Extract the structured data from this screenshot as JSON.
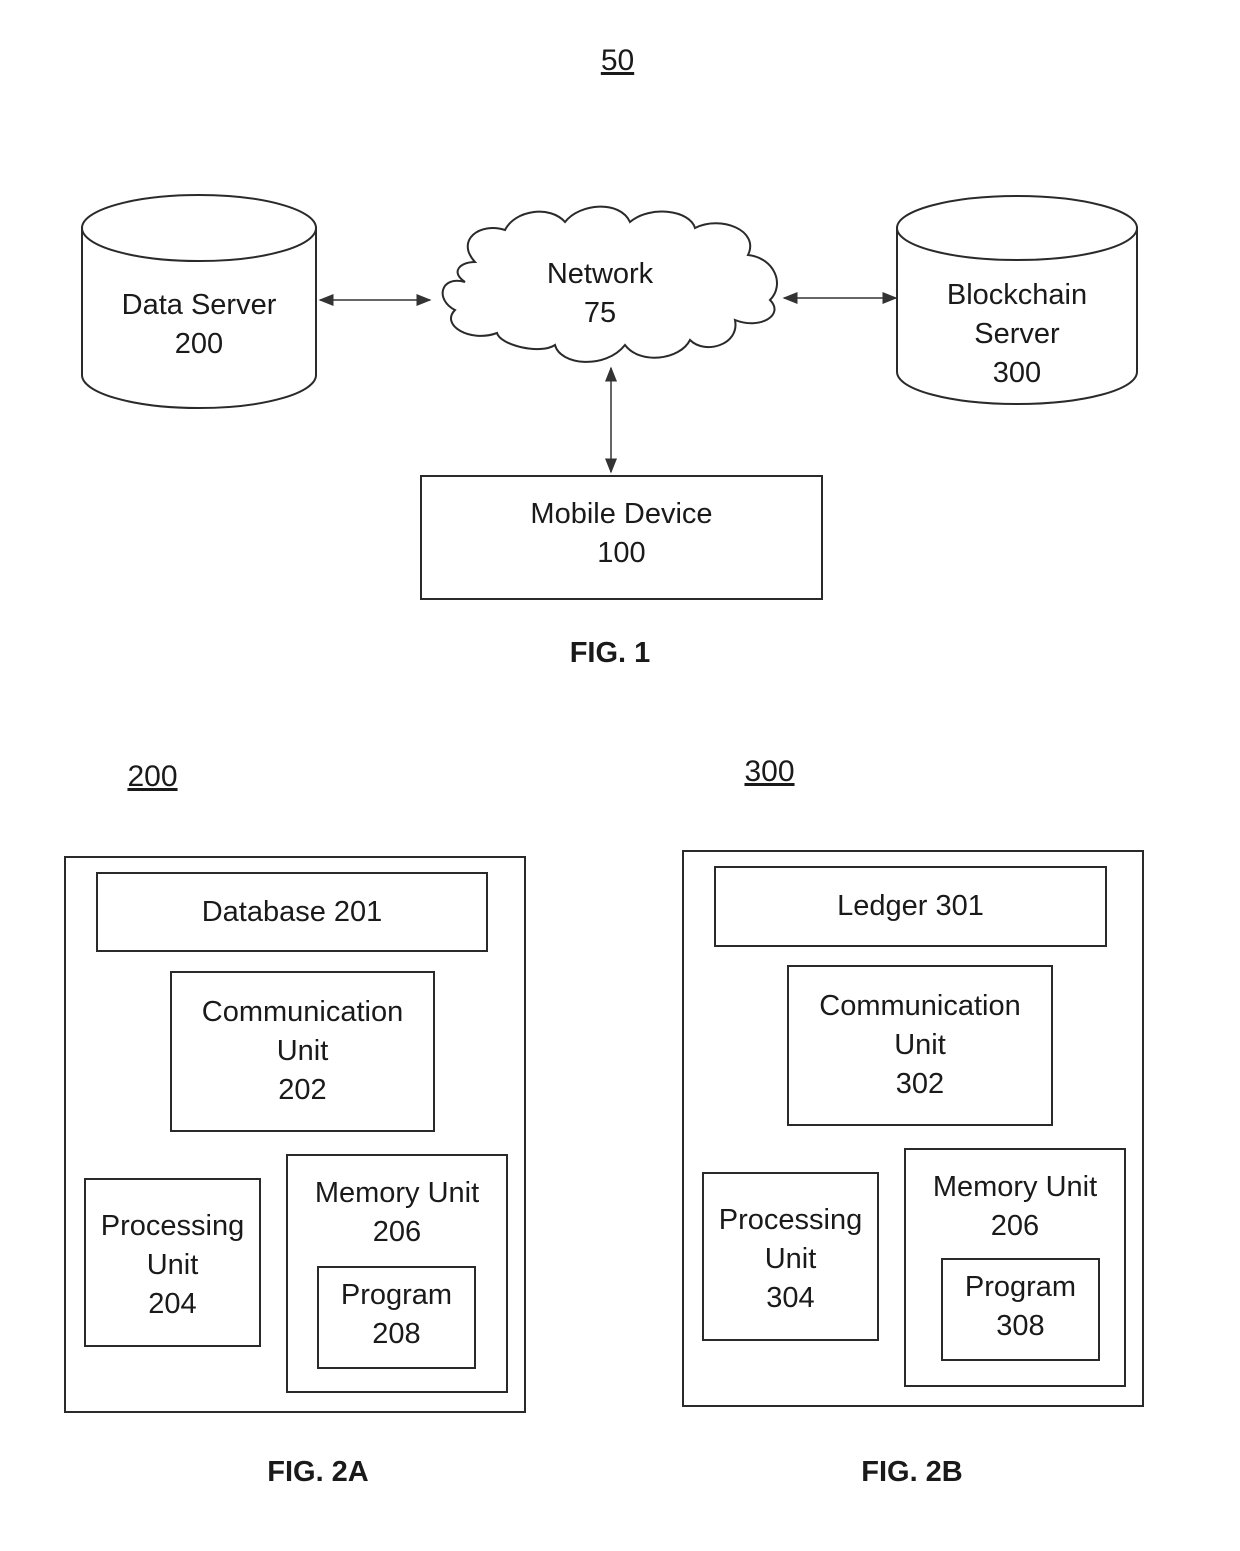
{
  "fig1": {
    "ref": "50",
    "caption": "FIG. 1",
    "data_server": {
      "name": "Data Server",
      "id": "200"
    },
    "network": {
      "name": "Network",
      "id": "75"
    },
    "blockchain_server": {
      "name": "Blockchain",
      "name2": "Server",
      "id": "300"
    },
    "mobile_device": {
      "name": "Mobile Device",
      "id": "100"
    }
  },
  "fig2a": {
    "ref": "200",
    "caption": "FIG. 2A",
    "database": "Database 201",
    "comm": {
      "line1": "Communication",
      "line2": "Unit",
      "id": "202"
    },
    "proc": {
      "line1": "Processing",
      "line2": "Unit",
      "id": "204"
    },
    "mem": {
      "line1": "Memory Unit",
      "id": "206"
    },
    "prog": {
      "line1": "Program",
      "id": "208"
    }
  },
  "fig2b": {
    "ref": "300",
    "caption": "FIG. 2B",
    "ledger": "Ledger 301",
    "comm": {
      "line1": "Communication",
      "line2": "Unit",
      "id": "302"
    },
    "proc": {
      "line1": "Processing",
      "line2": "Unit",
      "id": "304"
    },
    "mem": {
      "line1": "Memory Unit",
      "id": "206"
    },
    "prog": {
      "line1": "Program",
      "id": "308"
    }
  }
}
